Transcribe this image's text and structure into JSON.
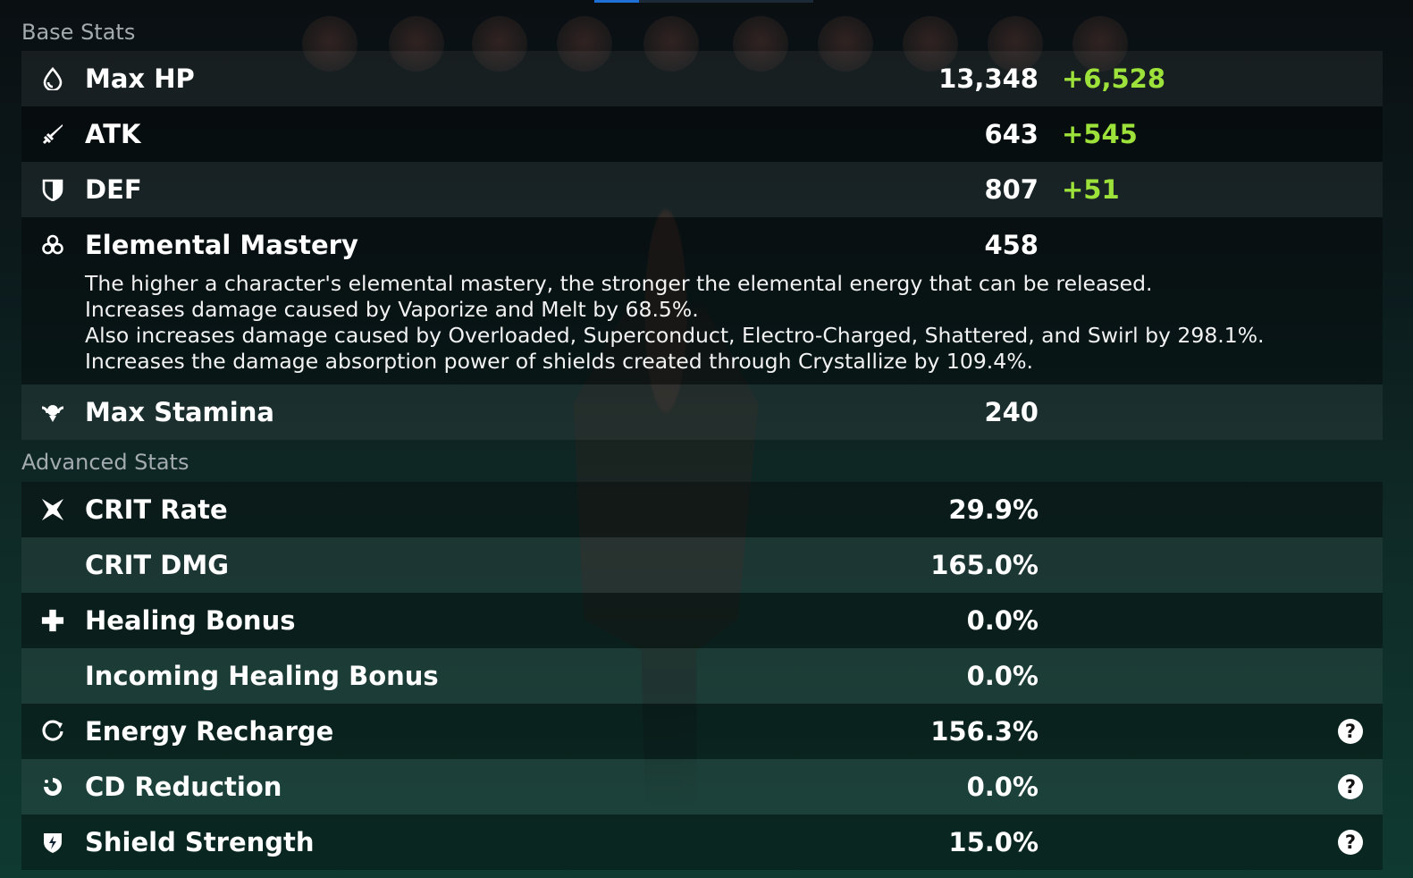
{
  "sections": {
    "base_title": "Base Stats",
    "advanced_title": "Advanced Stats"
  },
  "base_stats": {
    "max_hp": {
      "label": "Max HP",
      "value": "13,348",
      "bonus": "+6,528",
      "icon": "hp-drop-icon"
    },
    "atk": {
      "label": "ATK",
      "value": "643",
      "bonus": "+545",
      "icon": "sword-icon"
    },
    "def": {
      "label": "DEF",
      "value": "807",
      "bonus": "+51",
      "icon": "shield-icon"
    },
    "elemental_mastery": {
      "label": "Elemental Mastery",
      "value": "458",
      "icon": "elemental-mastery-icon",
      "description": [
        "The higher a character's elemental mastery, the stronger the elemental energy that can be released.",
        "Increases damage caused by Vaporize and Melt by 68.5%.",
        "Also increases damage caused by Overloaded, Superconduct, Electro-Charged, Shattered, and Swirl by 298.1%.",
        "Increases the damage absorption power of shields created through Crystallize by 109.4%."
      ]
    },
    "max_stamina": {
      "label": "Max Stamina",
      "value": "240",
      "icon": "stamina-icon"
    }
  },
  "advanced_stats": {
    "crit_rate": {
      "label": "CRIT Rate",
      "value": "29.9%",
      "icon": "crit-icon"
    },
    "crit_dmg": {
      "label": "CRIT DMG",
      "value": "165.0%"
    },
    "healing_bonus": {
      "label": "Healing Bonus",
      "value": "0.0%",
      "icon": "plus-icon"
    },
    "incoming_healing": {
      "label": "Incoming Healing Bonus",
      "value": "0.0%"
    },
    "energy_recharge": {
      "label": "Energy Recharge",
      "value": "156.3%",
      "icon": "energy-recharge-icon",
      "help": "?"
    },
    "cd_reduction": {
      "label": "CD Reduction",
      "value": "0.0%",
      "icon": "cd-reduction-icon",
      "help": "?"
    },
    "shield_strength": {
      "label": "Shield Strength",
      "value": "15.0%",
      "icon": "shield-strength-icon",
      "help": "?"
    }
  },
  "colors": {
    "bonus": "#9de23a",
    "section_title": "#a3abb0",
    "accent_tab": "#1e6fd6"
  }
}
